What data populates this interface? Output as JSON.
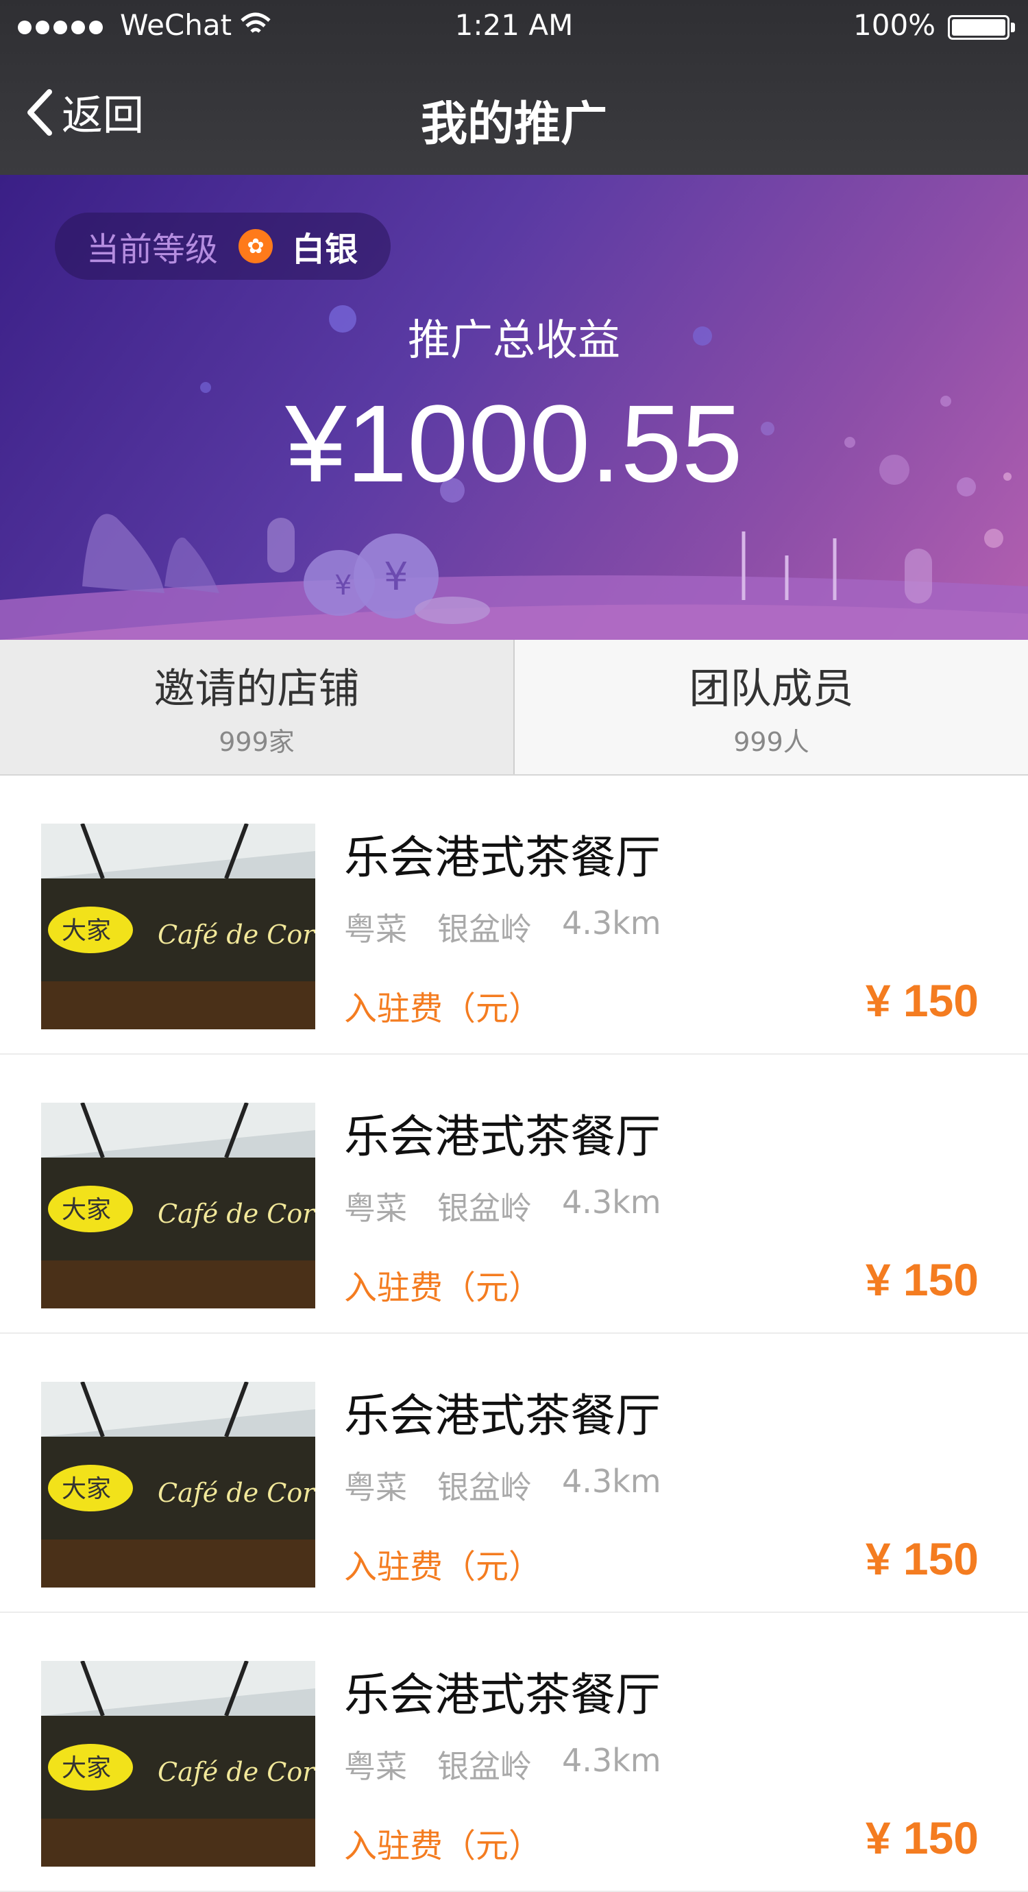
{
  "status_bar": {
    "carrier": "WeChat",
    "time": "1:21 AM",
    "battery": "100%"
  },
  "nav": {
    "back_label": "返回",
    "title": "我的推广"
  },
  "hero": {
    "level_label": "当前等级",
    "level_value": "白银",
    "earnings_label": "推广总收益",
    "earnings_amount": "¥1000.55"
  },
  "tabs": [
    {
      "title": "邀请的店铺",
      "count": "999家"
    },
    {
      "title": "团队成员",
      "count": "999人"
    }
  ],
  "stores": [
    {
      "name": "乐会港式茶餐厅",
      "cuisine": "粤菜",
      "area": "银盆岭",
      "distance": "4.3km",
      "fee_label": "入驻费（元）",
      "fee": "¥ 150"
    },
    {
      "name": "乐会港式茶餐厅",
      "cuisine": "粤菜",
      "area": "银盆岭",
      "distance": "4.3km",
      "fee_label": "入驻费（元）",
      "fee": "¥ 150"
    },
    {
      "name": "乐会港式茶餐厅",
      "cuisine": "粤菜",
      "area": "银盆岭",
      "distance": "4.3km",
      "fee_label": "入驻费（元）",
      "fee": "¥ 150"
    },
    {
      "name": "乐会港式茶餐厅",
      "cuisine": "粤菜",
      "area": "银盆岭",
      "distance": "4.3km",
      "fee_label": "入驻费（元）",
      "fee": "¥ 150"
    }
  ],
  "colors": {
    "accent": "#f47c20",
    "nav_bg": "#333336",
    "hero_start": "#3a1f86",
    "hero_end": "#b460b0"
  }
}
